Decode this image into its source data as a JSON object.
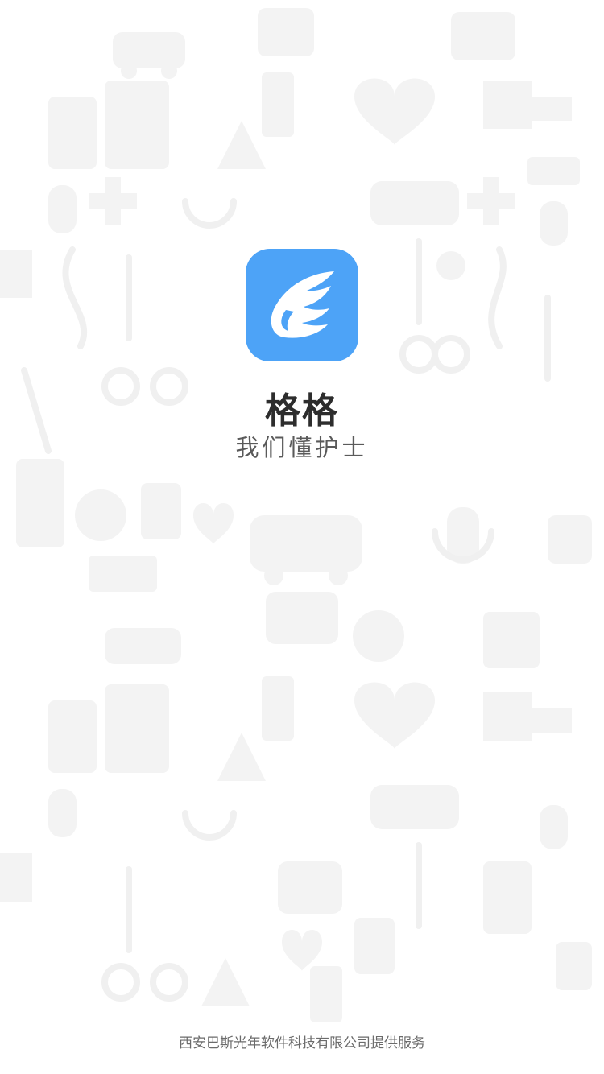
{
  "splash": {
    "app_name": "格格",
    "slogan": "我们懂护士",
    "footer": "西安巴斯光年软件科技有限公司提供服务",
    "brand_color": "#4da3f7",
    "logo_icon": "wing-icon",
    "background_pattern": "medical-icons-pattern"
  }
}
